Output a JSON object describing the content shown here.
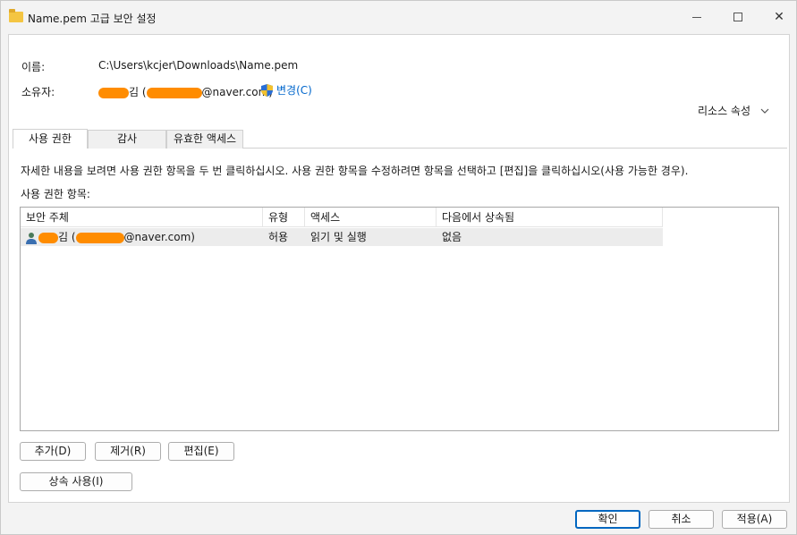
{
  "window": {
    "title": "Name.pem 고급 보안 설정",
    "accent": "#0067c0"
  },
  "object": {
    "name_label": "이름:",
    "name_value": "C:\\Users\\kcjer\\Downloads\\Name.pem",
    "owner_label": "소유자:",
    "owner_suffix_1": "김 (",
    "owner_suffix_2": "@naver.com)",
    "change_link": "변경(C)",
    "change_icon": "uac-shield-icon"
  },
  "resource_properties": {
    "label": "리소스 속성",
    "icon": "chevron-down-icon"
  },
  "tabs": [
    {
      "label": "사용 권한",
      "active": true
    },
    {
      "label": "감사",
      "active": false
    },
    {
      "label": "유효한 액세스",
      "active": false
    }
  ],
  "permissions": {
    "description": "자세한 내용을 보려면 사용 권한 항목을 두 번 클릭하십시오. 사용 권한 항목을 수정하려면 항목을 선택하고 [편집]을 클릭하십시오(사용 가능한 경우).",
    "entries_label": "사용 권한 항목:",
    "columns": [
      "보안 주체",
      "유형",
      "액세스",
      "다음에서 상속됨"
    ],
    "rows": [
      {
        "principal_1": "김 (",
        "principal_2": "@naver.com)",
        "type": "허용",
        "access": "읽기 및 실행",
        "inherited_from": "없음",
        "icon": "user-icon"
      }
    ]
  },
  "buttons": {
    "add": "추가(D)",
    "remove": "제거(R)",
    "edit": "편집(E)",
    "inheritance": "상속 사용(I)",
    "ok": "확인",
    "cancel": "취소",
    "apply": "적용(A)"
  },
  "redaction_color": "#ff8c00"
}
